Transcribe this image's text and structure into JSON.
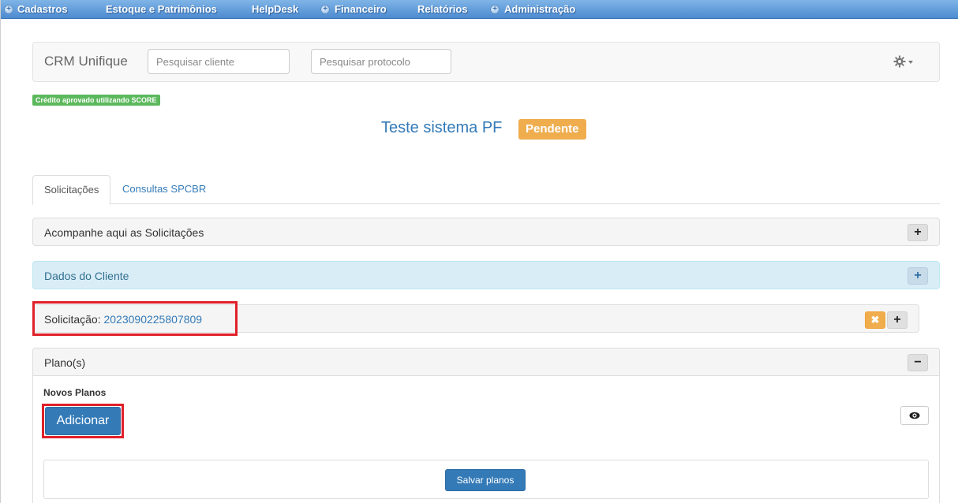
{
  "menu": {
    "items": [
      {
        "label": "Cadastros",
        "has_plus": true
      },
      {
        "label": "Estoque e Patrimônios",
        "has_plus": false
      },
      {
        "label": "HelpDesk",
        "has_plus": false
      },
      {
        "label": "Financeiro",
        "has_plus": true
      },
      {
        "label": "Relatórios",
        "has_plus": false
      },
      {
        "label": "Administração",
        "has_plus": true
      }
    ]
  },
  "navbar": {
    "brand": "CRM Unifique",
    "search_client_placeholder": "Pesquisar cliente",
    "search_protocol_placeholder": "Pesquisar protocolo",
    "settings_icon": "gear-icon"
  },
  "score_label": "Crédito aprovado utilizando SCORE",
  "client": {
    "name": "Teste sistema PF",
    "status": "Pendente"
  },
  "tabs": [
    {
      "label": "Solicitações",
      "active": true
    },
    {
      "label": "Consultas SPCBR",
      "active": false
    }
  ],
  "panels": {
    "acompanhe": "Acompanhe aqui as Solicitações",
    "dados_cliente": "Dados do Cliente",
    "solicitacao_label": "Solicitação:",
    "solicitacao_id": "2023090225807809",
    "planos": "Plano(s)"
  },
  "plans": {
    "novos_label": "Novos Planos",
    "add_button": "Adicionar",
    "save_button": "Salvar planos"
  },
  "colors": {
    "primary": "#337ab7",
    "warning": "#f0ad4e",
    "success": "#5cb85c",
    "highlight": "#e0202a"
  }
}
